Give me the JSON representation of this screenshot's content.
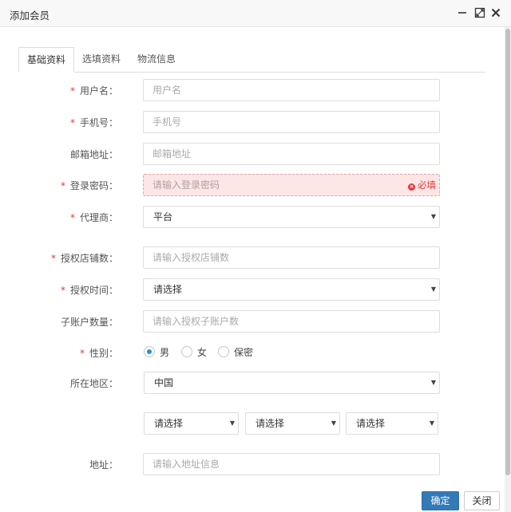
{
  "window": {
    "title": "添加会员"
  },
  "tabs": [
    {
      "label": "基础资料",
      "active": true
    },
    {
      "label": "选填资料",
      "active": false
    },
    {
      "label": "物流信息",
      "active": false
    }
  ],
  "fields": {
    "username": {
      "label": "用户名：",
      "required": "*",
      "placeholder": "用户名"
    },
    "phone": {
      "label": "手机号：",
      "required": "*",
      "placeholder": "手机号"
    },
    "email": {
      "label": "邮箱地址：",
      "placeholder": "邮箱地址"
    },
    "password": {
      "label": "登录密码：",
      "required": "*",
      "placeholder": "请输入登录密码",
      "error": "必填"
    },
    "agent": {
      "label": "代理商：",
      "required": "*",
      "value": "平台"
    },
    "store_count": {
      "label": "授权店铺数：",
      "required": "*",
      "placeholder": "请输入授权店铺数"
    },
    "auth_time": {
      "label": "授权时间：",
      "required": "*",
      "value": "请选择"
    },
    "sub_accounts": {
      "label": "子账户数量：",
      "placeholder": "请输入授权子账户数"
    },
    "gender": {
      "label": "性别：",
      "required": "*",
      "options": [
        "男",
        "女",
        "保密"
      ],
      "selected": "男"
    },
    "region": {
      "label": "所在地区：",
      "country": "中国",
      "province": "请选择",
      "city": "请选择",
      "district": "请选择"
    },
    "address": {
      "label": "地址：",
      "placeholder": "请输入地址信息"
    }
  },
  "footer": {
    "confirm": "确定",
    "close": "关闭"
  },
  "icons": {
    "caret": "▼",
    "error": "×"
  },
  "colors": {
    "primary": "#337ab7",
    "required": "#e4393c",
    "error_bg": "#fce6e6",
    "radio": "#2f8ccf"
  }
}
